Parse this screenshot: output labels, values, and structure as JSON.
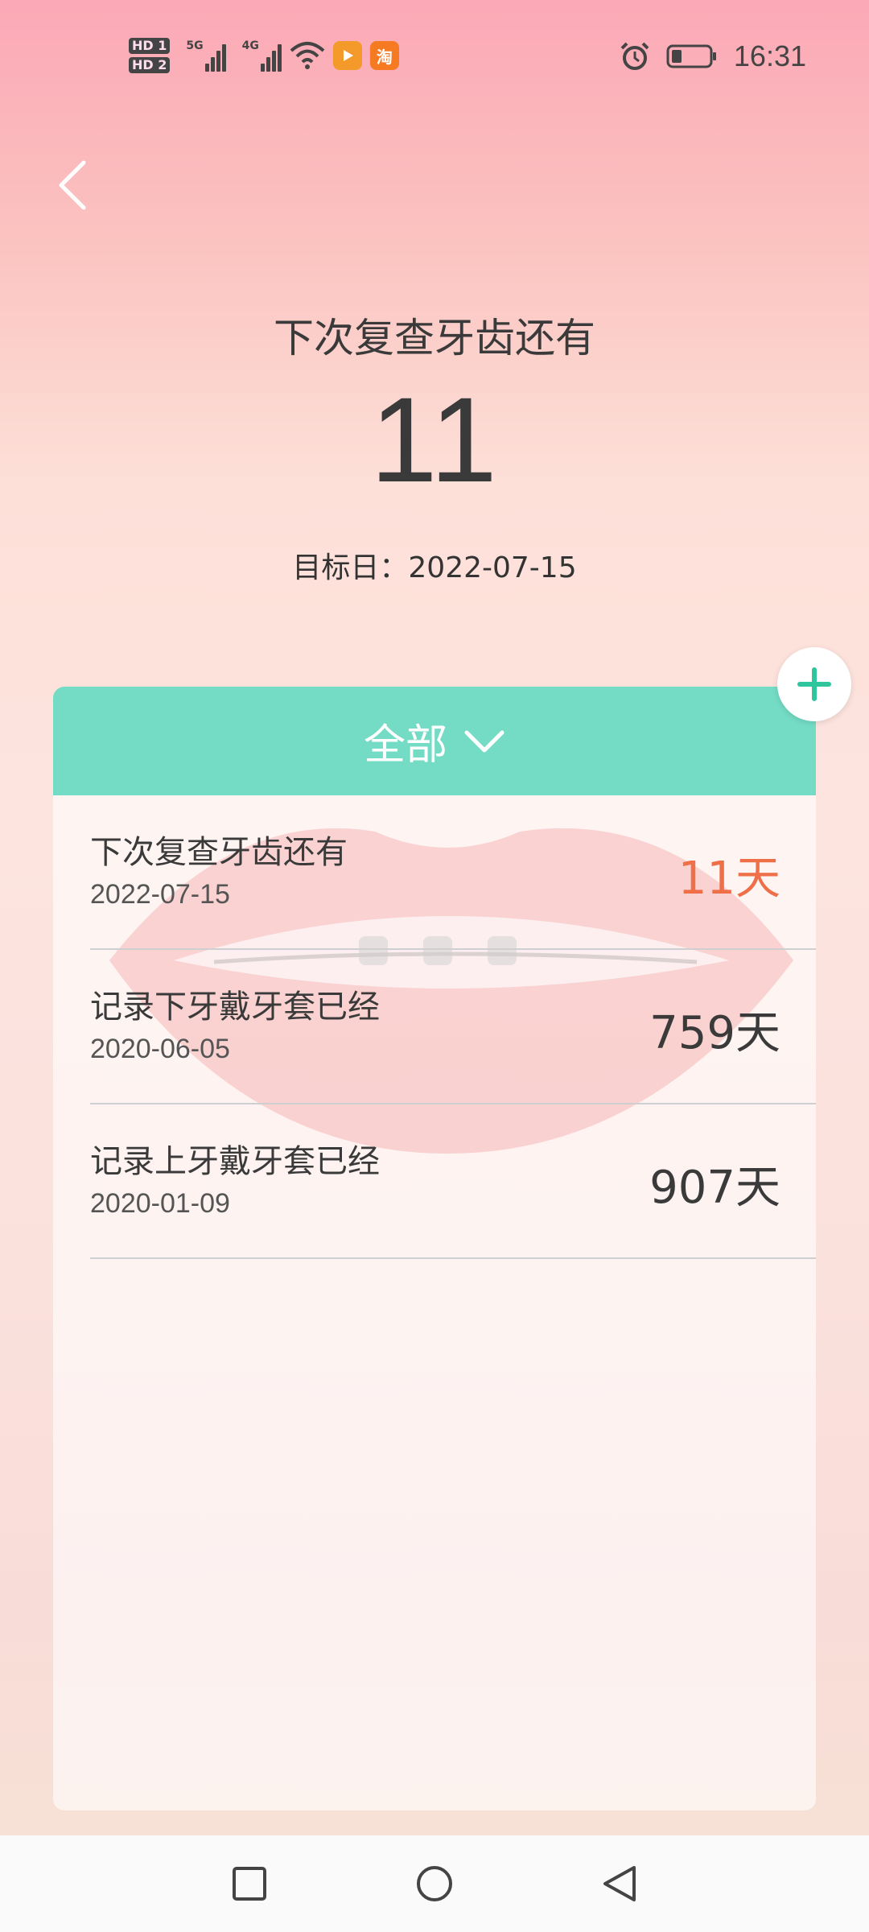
{
  "status_bar": {
    "hd1": "HD 1",
    "hd2": "HD 2",
    "net1": "5G",
    "net2": "4G",
    "app_badge_1_icon": "video-app-icon",
    "app_badge_2_text": "淘",
    "time": "16:31"
  },
  "header": {
    "headline": "下次复查牙齿还有",
    "big_number": "11",
    "target_date": "目标日：2022-07-15"
  },
  "card": {
    "filter_label": "全部",
    "items": [
      {
        "title": "下次复查牙齿还有",
        "date": "2022-07-15",
        "days": "11天",
        "highlight": true
      },
      {
        "title": "记录下牙戴牙套已经",
        "date": "2020-06-05",
        "days": "759天",
        "highlight": false
      },
      {
        "title": "记录上牙戴牙套已经",
        "date": "2020-01-09",
        "days": "907天",
        "highlight": false
      }
    ]
  },
  "colors": {
    "accent": "#74dcc5",
    "highlight": "#ee6f48",
    "background_top": "#fba8b6"
  }
}
